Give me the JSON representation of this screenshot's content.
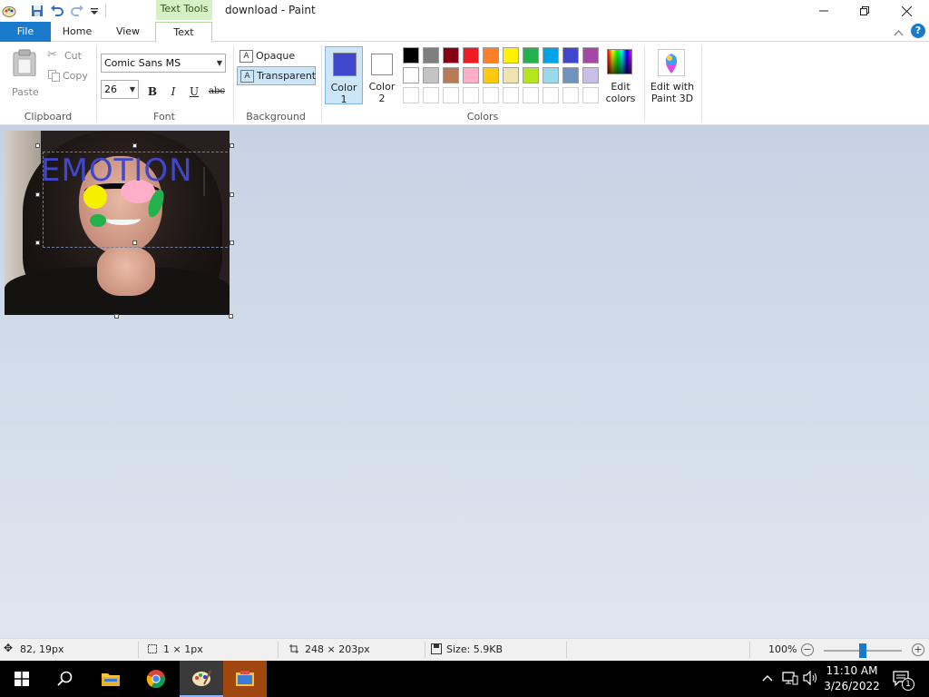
{
  "window": {
    "title": "download - Paint",
    "context_tab_group": "Text Tools"
  },
  "tabs": [
    {
      "label": "File"
    },
    {
      "label": "Home"
    },
    {
      "label": "View"
    },
    {
      "label": "Text"
    }
  ],
  "ribbon": {
    "clipboard": {
      "group_label": "Clipboard",
      "paste_label": "Paste",
      "cut_label": "Cut",
      "copy_label": "Copy"
    },
    "font": {
      "group_label": "Font",
      "font_family_value": "Comic Sans MS",
      "font_size_value": "26",
      "bold_label": "B",
      "italic_label": "I",
      "underline_label": "U",
      "strike_label": "abc"
    },
    "background": {
      "group_label": "Background",
      "opaque_label": "Opaque",
      "transparent_label": "Transparent"
    },
    "colors": {
      "group_label": "Colors",
      "color1_label": "Color",
      "color1_num": "1",
      "color2_label": "Color",
      "color2_num": "2",
      "color1_value": "#3f48cc",
      "color2_value": "#ffffff",
      "palette_row1": [
        "#000000",
        "#7f7f7f",
        "#880015",
        "#ed1c24",
        "#ff7f27",
        "#fff200",
        "#22b14c",
        "#00a2e8",
        "#3f48cc",
        "#a349a4"
      ],
      "palette_row2": [
        "#ffffff",
        "#c3c3c3",
        "#b97a57",
        "#ffaec9",
        "#ffc90e",
        "#efe4b0",
        "#b5e61d",
        "#99d9ea",
        "#7092be",
        "#c8bfe7"
      ],
      "edit_colors_line1": "Edit",
      "edit_colors_line2": "colors",
      "paint3d_line1": "Edit with",
      "paint3d_line2": "Paint 3D"
    }
  },
  "canvas": {
    "text_content": "EMOTION",
    "text_color": "#3f48cc"
  },
  "status": {
    "cursor_pos": "82, 19px",
    "selection_size": "1 × 1px",
    "image_size": "248 × 203px",
    "file_size": "Size: 5.9KB",
    "zoom": "100%",
    "zoom_level_fraction": 0.5
  },
  "taskbar": {
    "time": "11:10 AM",
    "date": "3/26/2022",
    "notification_count": "1"
  }
}
